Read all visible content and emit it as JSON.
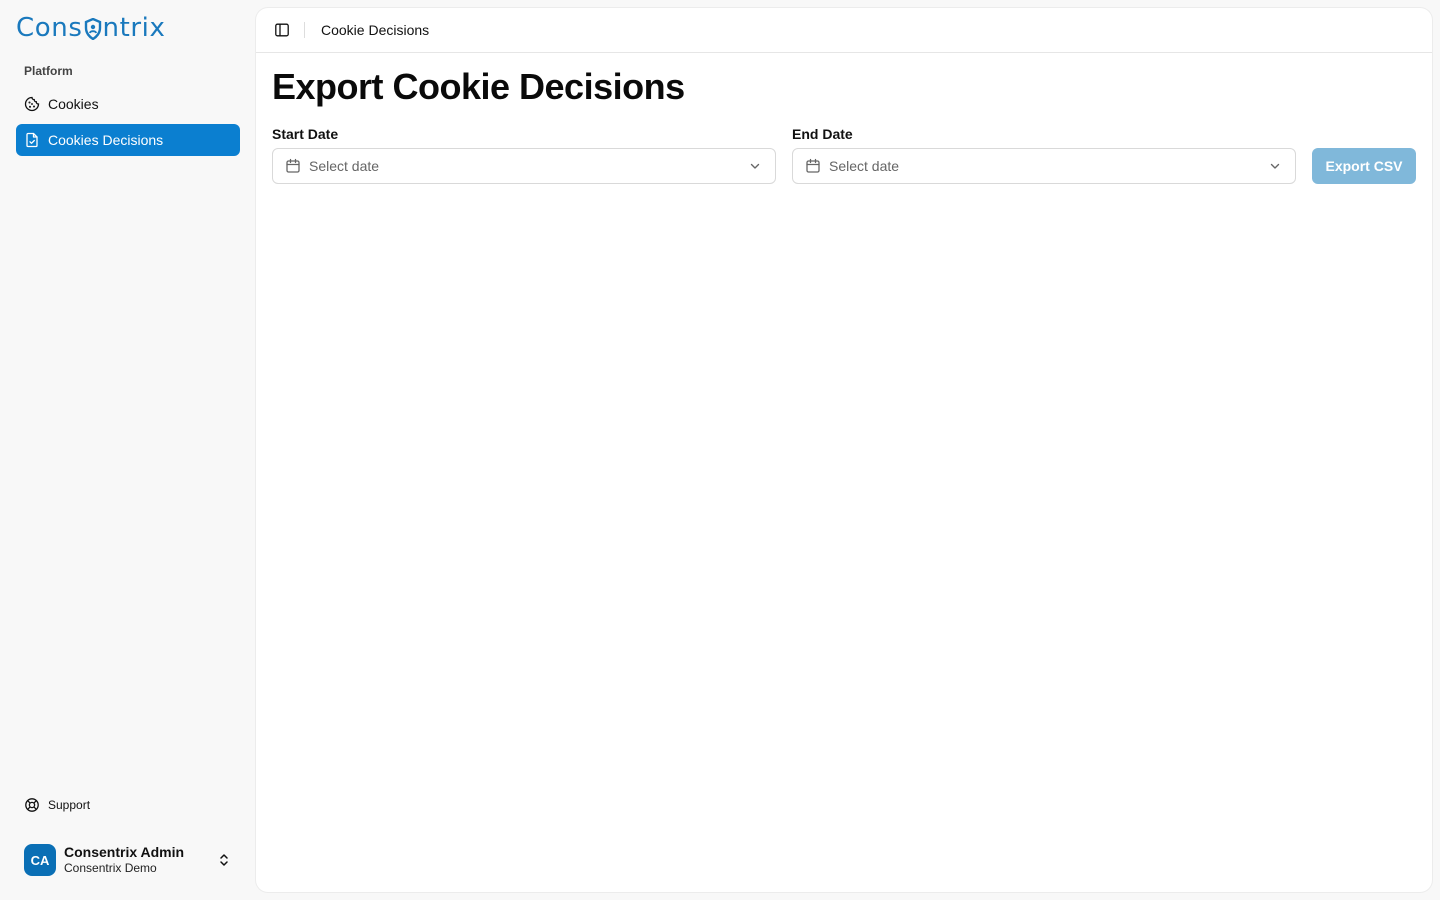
{
  "brand": {
    "logo_text_left": "Cons",
    "logo_text_right": "ntrix",
    "color": "#1a79bd"
  },
  "sidebar": {
    "section_label": "Platform",
    "items": [
      {
        "label": "Cookies",
        "icon": "cookie-icon",
        "active": false
      },
      {
        "label": "Cookies Decisions",
        "icon": "file-check-icon",
        "active": true
      }
    ],
    "support_label": "Support",
    "user": {
      "initials": "CA",
      "name": "Consentrix Admin",
      "org": "Consentrix Demo"
    }
  },
  "header": {
    "breadcrumb": "Cookie Decisions"
  },
  "main": {
    "title": "Export Cookie Decisions",
    "start_date": {
      "label": "Start Date",
      "placeholder": "Select date"
    },
    "end_date": {
      "label": "End Date",
      "placeholder": "Select date"
    },
    "export_label": "Export CSV"
  },
  "colors": {
    "accent": "#0b7fd0",
    "export_disabled": "#80b8da",
    "avatar": "#0a6fb5"
  }
}
